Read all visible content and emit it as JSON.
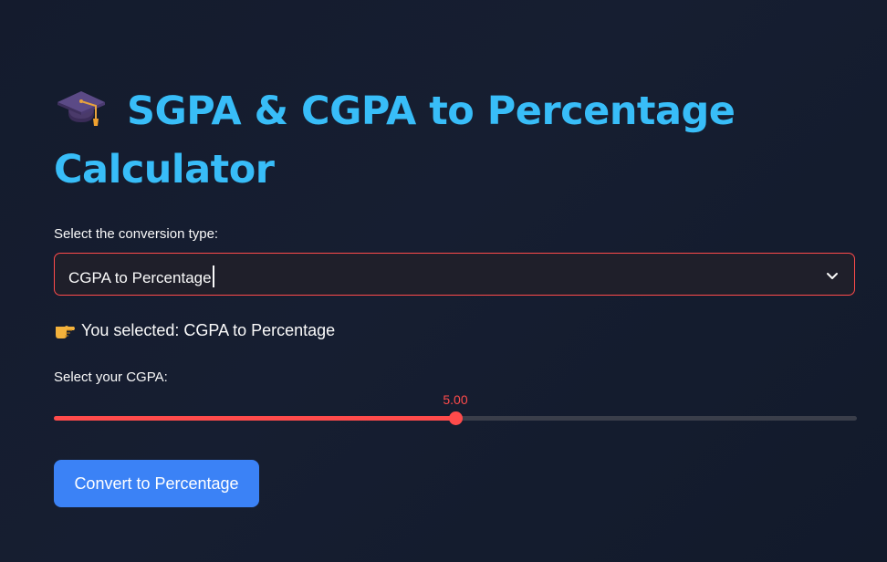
{
  "header": {
    "title": "SGPA & CGPA to Percentage Calculator",
    "title_icon": "graduation-cap-icon"
  },
  "conversion": {
    "label": "Select the conversion type:",
    "selected_value": "CGPA to Percentage",
    "selected_message": "You selected: CGPA to Percentage",
    "message_icon": "pointing-hand-icon"
  },
  "cgpa_slider": {
    "label": "Select your CGPA:",
    "value": "5.00",
    "min": 0,
    "max": 10,
    "current": 5.0
  },
  "actions": {
    "convert_label": "Convert to Percentage"
  },
  "colors": {
    "title": "#38bdf8",
    "accent": "#ff4b4b",
    "button": "#3b82f6",
    "background": "#141b2d"
  }
}
